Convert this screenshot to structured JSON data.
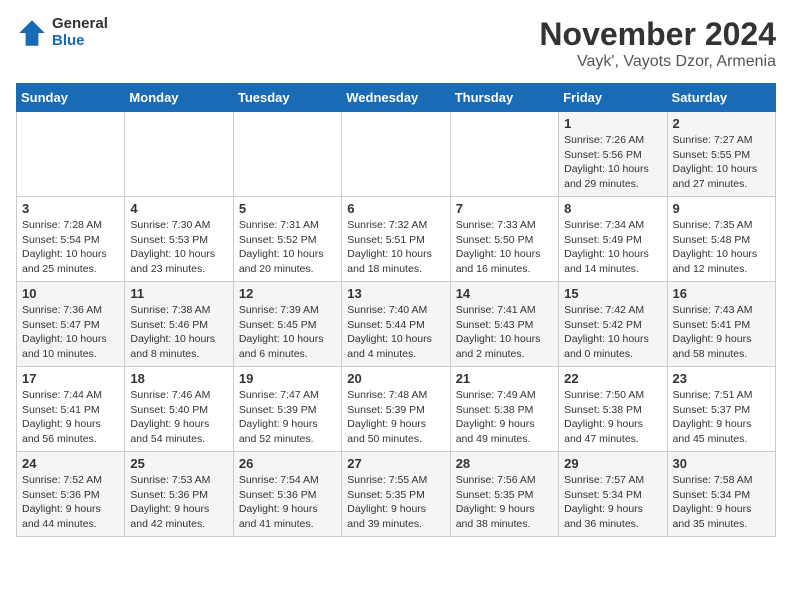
{
  "logo": {
    "general": "General",
    "blue": "Blue"
  },
  "title": "November 2024",
  "subtitle": "Vayk', Vayots Dzor, Armenia",
  "days_of_week": [
    "Sunday",
    "Monday",
    "Tuesday",
    "Wednesday",
    "Thursday",
    "Friday",
    "Saturday"
  ],
  "weeks": [
    [
      {
        "day": "",
        "info": ""
      },
      {
        "day": "",
        "info": ""
      },
      {
        "day": "",
        "info": ""
      },
      {
        "day": "",
        "info": ""
      },
      {
        "day": "",
        "info": ""
      },
      {
        "day": "1",
        "info": "Sunrise: 7:26 AM\nSunset: 5:56 PM\nDaylight: 10 hours and 29 minutes."
      },
      {
        "day": "2",
        "info": "Sunrise: 7:27 AM\nSunset: 5:55 PM\nDaylight: 10 hours and 27 minutes."
      }
    ],
    [
      {
        "day": "3",
        "info": "Sunrise: 7:28 AM\nSunset: 5:54 PM\nDaylight: 10 hours and 25 minutes."
      },
      {
        "day": "4",
        "info": "Sunrise: 7:30 AM\nSunset: 5:53 PM\nDaylight: 10 hours and 23 minutes."
      },
      {
        "day": "5",
        "info": "Sunrise: 7:31 AM\nSunset: 5:52 PM\nDaylight: 10 hours and 20 minutes."
      },
      {
        "day": "6",
        "info": "Sunrise: 7:32 AM\nSunset: 5:51 PM\nDaylight: 10 hours and 18 minutes."
      },
      {
        "day": "7",
        "info": "Sunrise: 7:33 AM\nSunset: 5:50 PM\nDaylight: 10 hours and 16 minutes."
      },
      {
        "day": "8",
        "info": "Sunrise: 7:34 AM\nSunset: 5:49 PM\nDaylight: 10 hours and 14 minutes."
      },
      {
        "day": "9",
        "info": "Sunrise: 7:35 AM\nSunset: 5:48 PM\nDaylight: 10 hours and 12 minutes."
      }
    ],
    [
      {
        "day": "10",
        "info": "Sunrise: 7:36 AM\nSunset: 5:47 PM\nDaylight: 10 hours and 10 minutes."
      },
      {
        "day": "11",
        "info": "Sunrise: 7:38 AM\nSunset: 5:46 PM\nDaylight: 10 hours and 8 minutes."
      },
      {
        "day": "12",
        "info": "Sunrise: 7:39 AM\nSunset: 5:45 PM\nDaylight: 10 hours and 6 minutes."
      },
      {
        "day": "13",
        "info": "Sunrise: 7:40 AM\nSunset: 5:44 PM\nDaylight: 10 hours and 4 minutes."
      },
      {
        "day": "14",
        "info": "Sunrise: 7:41 AM\nSunset: 5:43 PM\nDaylight: 10 hours and 2 minutes."
      },
      {
        "day": "15",
        "info": "Sunrise: 7:42 AM\nSunset: 5:42 PM\nDaylight: 10 hours and 0 minutes."
      },
      {
        "day": "16",
        "info": "Sunrise: 7:43 AM\nSunset: 5:41 PM\nDaylight: 9 hours and 58 minutes."
      }
    ],
    [
      {
        "day": "17",
        "info": "Sunrise: 7:44 AM\nSunset: 5:41 PM\nDaylight: 9 hours and 56 minutes."
      },
      {
        "day": "18",
        "info": "Sunrise: 7:46 AM\nSunset: 5:40 PM\nDaylight: 9 hours and 54 minutes."
      },
      {
        "day": "19",
        "info": "Sunrise: 7:47 AM\nSunset: 5:39 PM\nDaylight: 9 hours and 52 minutes."
      },
      {
        "day": "20",
        "info": "Sunrise: 7:48 AM\nSunset: 5:39 PM\nDaylight: 9 hours and 50 minutes."
      },
      {
        "day": "21",
        "info": "Sunrise: 7:49 AM\nSunset: 5:38 PM\nDaylight: 9 hours and 49 minutes."
      },
      {
        "day": "22",
        "info": "Sunrise: 7:50 AM\nSunset: 5:38 PM\nDaylight: 9 hours and 47 minutes."
      },
      {
        "day": "23",
        "info": "Sunrise: 7:51 AM\nSunset: 5:37 PM\nDaylight: 9 hours and 45 minutes."
      }
    ],
    [
      {
        "day": "24",
        "info": "Sunrise: 7:52 AM\nSunset: 5:36 PM\nDaylight: 9 hours and 44 minutes."
      },
      {
        "day": "25",
        "info": "Sunrise: 7:53 AM\nSunset: 5:36 PM\nDaylight: 9 hours and 42 minutes."
      },
      {
        "day": "26",
        "info": "Sunrise: 7:54 AM\nSunset: 5:36 PM\nDaylight: 9 hours and 41 minutes."
      },
      {
        "day": "27",
        "info": "Sunrise: 7:55 AM\nSunset: 5:35 PM\nDaylight: 9 hours and 39 minutes."
      },
      {
        "day": "28",
        "info": "Sunrise: 7:56 AM\nSunset: 5:35 PM\nDaylight: 9 hours and 38 minutes."
      },
      {
        "day": "29",
        "info": "Sunrise: 7:57 AM\nSunset: 5:34 PM\nDaylight: 9 hours and 36 minutes."
      },
      {
        "day": "30",
        "info": "Sunrise: 7:58 AM\nSunset: 5:34 PM\nDaylight: 9 hours and 35 minutes."
      }
    ]
  ]
}
